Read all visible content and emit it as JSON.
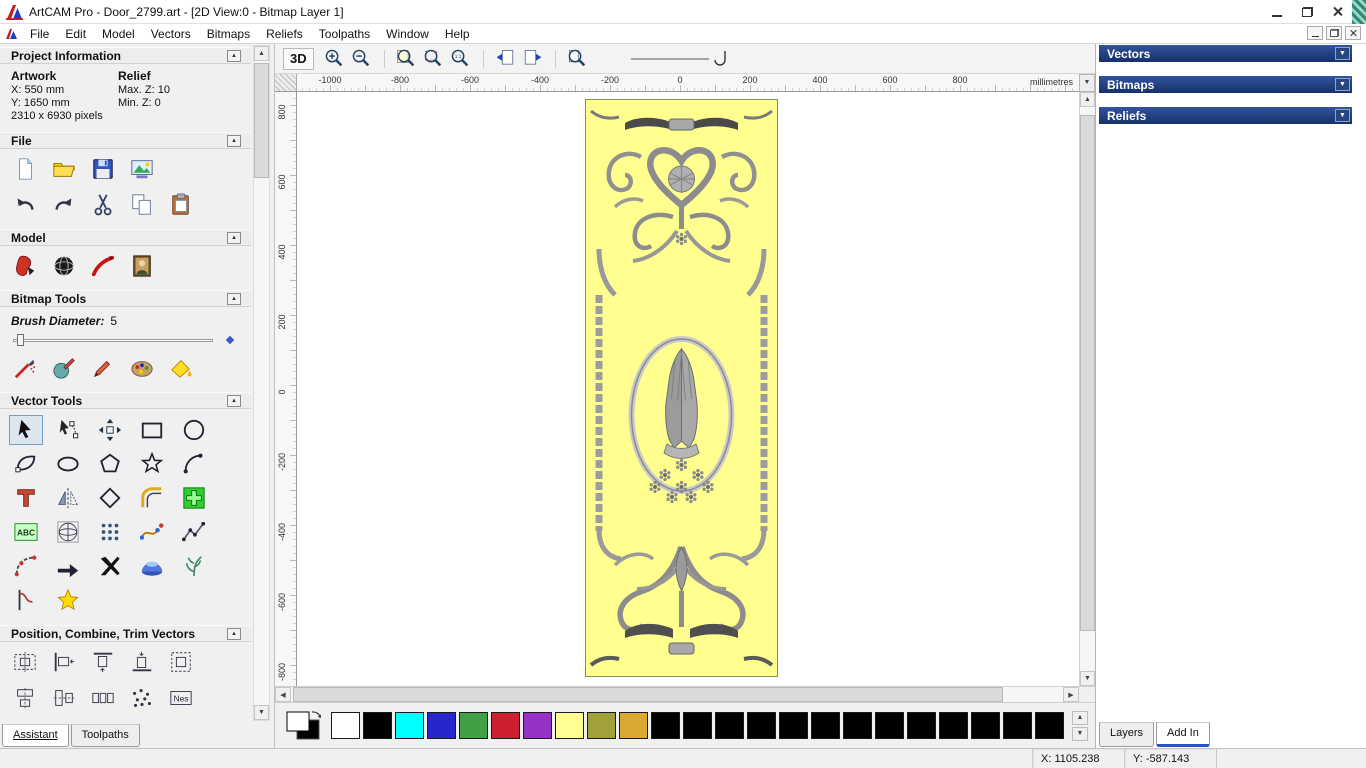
{
  "window": {
    "title": "ArtCAM Pro - Door_2799.art - [2D View:0 - Bitmap Layer 1]"
  },
  "menu": {
    "items": [
      "File",
      "Edit",
      "Model",
      "Vectors",
      "Bitmaps",
      "Reliefs",
      "Toolpaths",
      "Window",
      "Help"
    ]
  },
  "glyphs": {
    "collapse": "▲",
    "dropdown": "▼",
    "up": "▲",
    "down": "▼",
    "left": "◀",
    "right": "▶"
  },
  "assistant": {
    "active_tool": "select-vectors",
    "active_tab": "Assistant",
    "tabs": [
      "Assistant",
      "Toolpaths"
    ],
    "project_info": {
      "title": "Project Information",
      "artwork_label": "Artwork",
      "relief_label": "Relief",
      "artwork_x": "X: 550 mm",
      "artwork_y": "Y: 1650 mm",
      "relief_max": "Max. Z: 10",
      "relief_min": "Min. Z: 0",
      "pixels": "2310 x 6930 pixels"
    },
    "file_section": {
      "title": "File",
      "icons_row1": [
        "new-document",
        "open-file",
        "save-model",
        "import-image"
      ],
      "icons_row2": [
        "undo",
        "redo",
        "cut",
        "copy",
        "paste"
      ]
    },
    "model_section": {
      "title": "Model",
      "icons": [
        "load-relief",
        "sphere-model",
        "red-swoosh",
        "portrait"
      ]
    },
    "bitmap_section": {
      "title": "Bitmap Tools",
      "brush_label": "Brush Diameter:",
      "brush_value": "5",
      "icons": [
        "airbrush",
        "paint-relief",
        "paint-brush",
        "colour-set",
        "flood-fill"
      ]
    },
    "vector_section": {
      "title": "Vector Tools",
      "icons": [
        "select-vectors",
        "node-editing",
        "transform-vectors",
        "create-rectangle",
        "create-circle",
        "shape-editor",
        "create-ellipse",
        "create-polygon",
        "create-star",
        "create-arc",
        "create-text",
        "mirror-vectors",
        "offset-vector",
        "fillet-vectors",
        "green-cross",
        "text-abc",
        "wrap-sphere",
        "paste-array",
        "curve-fit",
        "polyline-points",
        "arc-three-points",
        "direction-arrow",
        "trim-knife",
        "extrude-dome",
        "create-fern",
        "section-profile",
        "star-wizard"
      ]
    },
    "position_section": {
      "title": "Position, Combine, Trim Vectors",
      "icons_row1": [
        "center-in-page",
        "align-left",
        "align-top",
        "align-bottom",
        "align-center"
      ],
      "icons_row2": [
        "align-h-centers",
        "align-v-centers",
        "distribute",
        "scatter",
        "nesting"
      ],
      "nesting_label": "Nes"
    }
  },
  "canvas": {
    "toolbar": {
      "view3d_label": "3D",
      "icons": [
        "zoom-in",
        "zoom-out",
        "|",
        "zoom-previous",
        "zoom-rect",
        "zoom-scale",
        "|",
        "page-left",
        "page-right",
        "|",
        "zoom-page"
      ]
    },
    "ruler": {
      "unit": "millimetres",
      "h_labels": [
        "-1000",
        "-800",
        "-600",
        "-400",
        "-200",
        "0",
        "200",
        "400",
        "600",
        "800"
      ],
      "v_labels": [
        "800",
        "600",
        "400",
        "200",
        "0",
        "-200",
        "-400",
        "-600",
        "-800"
      ]
    }
  },
  "right_panel": {
    "sections": [
      "Vectors",
      "Bitmaps",
      "Reliefs"
    ],
    "tabs": [
      "Layers",
      "Add In"
    ],
    "active_tab": "Add In",
    "header_color": "#1c3a7e"
  },
  "palette": {
    "colors": [
      "#ffffff",
      "#000000",
      "#00ffff",
      "#2626cc",
      "#3fa046",
      "#cc2030",
      "#9632c8",
      "#ffff94",
      "#a0a03c",
      "#d9a832",
      "#000000",
      "#000000",
      "#000000",
      "#000000",
      "#000000",
      "#000000",
      "#000000",
      "#000000",
      "#000000",
      "#000000",
      "#000000",
      "#000000",
      "#000000"
    ]
  },
  "status": {
    "x": "X: 1105.238",
    "y": "Y: -587.143"
  },
  "theme": {
    "door_yellow": "#ffff90",
    "panel_header_blue": "#1c3a7e"
  }
}
